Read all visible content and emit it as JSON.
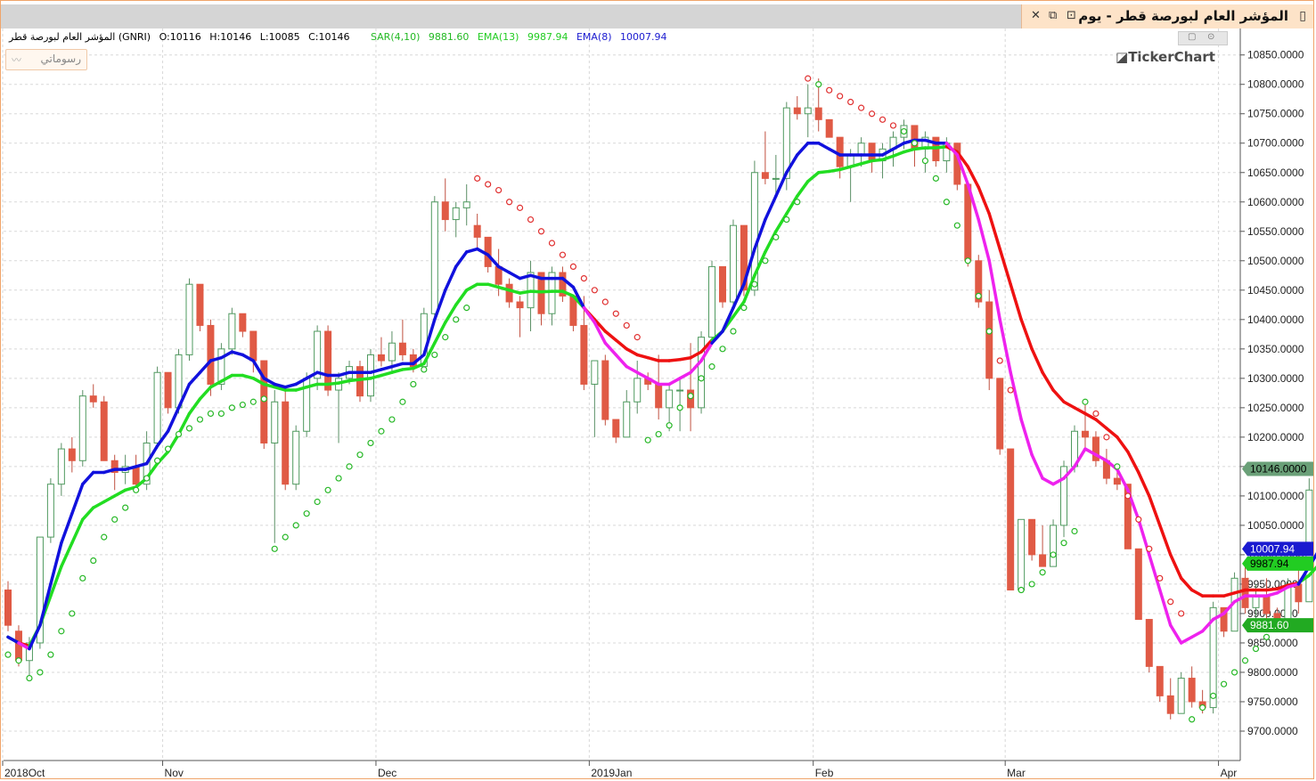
{
  "window": {
    "title": "المؤشر العام لبورصة قطر - يوم",
    "restore_icon": "restore-icon",
    "maximize_icon": "maximize-icon",
    "close_icon": "close-icon"
  },
  "info": {
    "symbol": "المؤشر العام لبورصة قطر (GNRI)",
    "ohlc": {
      "o": "O:10116",
      "h": "H:10146",
      "l": "L:10085",
      "c": "C:10146"
    },
    "indicators": [
      {
        "label": "SAR(4,10)",
        "value": "9881.60",
        "color": "#22b922"
      },
      {
        "label": "EMA(13)",
        "value": "9987.94",
        "color": "#22cc22"
      },
      {
        "label": "EMA(8)",
        "value": "10007.94",
        "color": "#1a1ad0"
      }
    ]
  },
  "drawings_label": "رسوماتي",
  "logo": "TickerChart",
  "chart_data": {
    "type": "candlestick",
    "ylim": [
      9650,
      10895
    ],
    "y_ticks": [
      "10850.0000",
      "10800.0000",
      "10750.0000",
      "10700.0000",
      "10650.0000",
      "10600.0000",
      "10550.0000",
      "10500.0000",
      "10450.0000",
      "10400.0000",
      "10350.0000",
      "10300.0000",
      "10250.0000",
      "10200.0000",
      "10150.0000",
      "10100.0000",
      "10050.0000",
      "10000.0000",
      "9950.0000",
      "9900.0000",
      "9850.0000",
      "9800.0000",
      "9750.0000",
      "9700.0000"
    ],
    "x_labels": [
      {
        "label": "2018Oct",
        "index": 0
      },
      {
        "label": "Nov",
        "index": 15
      },
      {
        "label": "Dec",
        "index": 35
      },
      {
        "label": "2019Jan",
        "index": 55
      },
      {
        "label": "Feb",
        "index": 76
      },
      {
        "label": "Mar",
        "index": 94
      },
      {
        "label": "Apr",
        "index": 114
      }
    ],
    "candles": [
      [
        9940,
        9955,
        9870,
        9880
      ],
      [
        9870,
        9880,
        9810,
        9820
      ],
      [
        9820,
        9860,
        9790,
        9850
      ],
      [
        9850,
        10030,
        9840,
        10030
      ],
      [
        10030,
        10130,
        10020,
        10120
      ],
      [
        10120,
        10190,
        10100,
        10180
      ],
      [
        10180,
        10200,
        10140,
        10160
      ],
      [
        10160,
        10280,
        10150,
        10270
      ],
      [
        10270,
        10290,
        10250,
        10260
      ],
      [
        10260,
        10270,
        10160,
        10160
      ],
      [
        10160,
        10170,
        10110,
        10140
      ],
      [
        10140,
        10170,
        10120,
        10150
      ],
      [
        10150,
        10170,
        10110,
        10120
      ],
      [
        10120,
        10210,
        10110,
        10190
      ],
      [
        10190,
        10320,
        10180,
        10310
      ],
      [
        10310,
        10300,
        10240,
        10250
      ],
      [
        10250,
        10350,
        10240,
        10340
      ],
      [
        10340,
        10470,
        10330,
        10460
      ],
      [
        10460,
        10440,
        10380,
        10390
      ],
      [
        10390,
        10400,
        10270,
        10290
      ],
      [
        10290,
        10360,
        10280,
        10350
      ],
      [
        10350,
        10420,
        10340,
        10410
      ],
      [
        10410,
        10410,
        10370,
        10380
      ],
      [
        10380,
        10380,
        10310,
        10330
      ],
      [
        10330,
        10320,
        10180,
        10190
      ],
      [
        10190,
        10280,
        10020,
        10260
      ],
      [
        10260,
        10280,
        10110,
        10120
      ],
      [
        10120,
        10220,
        10110,
        10210
      ],
      [
        10210,
        10310,
        10200,
        10300
      ],
      [
        10300,
        10390,
        10280,
        10380
      ],
      [
        10380,
        10390,
        10270,
        10280
      ],
      [
        10280,
        10310,
        10190,
        10300
      ],
      [
        10300,
        10330,
        10290,
        10320
      ],
      [
        10320,
        10330,
        10260,
        10270
      ],
      [
        10270,
        10350,
        10260,
        10340
      ],
      [
        10340,
        10370,
        10320,
        10330
      ],
      [
        10330,
        10380,
        10310,
        10360
      ],
      [
        10360,
        10400,
        10330,
        10340
      ],
      [
        10340,
        10350,
        10310,
        10320
      ],
      [
        10320,
        10420,
        10310,
        10410
      ],
      [
        10410,
        10610,
        10400,
        10600
      ],
      [
        10600,
        10640,
        10550,
        10570
      ],
      [
        10570,
        10600,
        10540,
        10590
      ],
      [
        10590,
        10630,
        10560,
        10600
      ],
      [
        10560,
        10580,
        10520,
        10540
      ],
      [
        10540,
        10540,
        10480,
        10490
      ],
      [
        10490,
        10520,
        10440,
        10460
      ],
      [
        10460,
        10470,
        10420,
        10430
      ],
      [
        10430,
        10440,
        10370,
        10420
      ],
      [
        10420,
        10500,
        10380,
        10480
      ],
      [
        10480,
        10480,
        10390,
        10410
      ],
      [
        10410,
        10490,
        10390,
        10480
      ],
      [
        10480,
        10490,
        10430,
        10440
      ],
      [
        10440,
        10430,
        10380,
        10390
      ],
      [
        10390,
        10440,
        10280,
        10290
      ],
      [
        10290,
        10310,
        10200,
        10330
      ],
      [
        10330,
        10340,
        10220,
        10230
      ],
      [
        10230,
        10230,
        10190,
        10200
      ],
      [
        10200,
        10280,
        10200,
        10260
      ],
      [
        10260,
        10330,
        10240,
        10300
      ],
      [
        10300,
        10310,
        10280,
        10290
      ],
      [
        10290,
        10340,
        10230,
        10250
      ],
      [
        10250,
        10290,
        10210,
        10280
      ],
      [
        10280,
        10300,
        10210,
        10280
      ],
      [
        10280,
        10360,
        10210,
        10250
      ],
      [
        10250,
        10380,
        10240,
        10370
      ],
      [
        10370,
        10500,
        10360,
        10490
      ],
      [
        10490,
        10480,
        10420,
        10430
      ],
      [
        10430,
        10570,
        10420,
        10560
      ],
      [
        10560,
        10540,
        10440,
        10450
      ],
      [
        10450,
        10670,
        10440,
        10650
      ],
      [
        10650,
        10720,
        10630,
        10640
      ],
      [
        10640,
        10680,
        10610,
        10640
      ],
      [
        10640,
        10770,
        10620,
        10760
      ],
      [
        10760,
        10780,
        10740,
        10750
      ],
      [
        10750,
        10800,
        10710,
        10760
      ],
      [
        10760,
        10810,
        10720,
        10740
      ],
      [
        10740,
        10710,
        10710,
        10710
      ],
      [
        10710,
        10700,
        10640,
        10660
      ],
      [
        10660,
        10690,
        10600,
        10680
      ],
      [
        10680,
        10710,
        10660,
        10700
      ],
      [
        10700,
        10690,
        10650,
        10670
      ],
      [
        10670,
        10700,
        10640,
        10690
      ],
      [
        10690,
        10720,
        10660,
        10710
      ],
      [
        10710,
        10740,
        10690,
        10730
      ],
      [
        10730,
        10700,
        10660,
        10690
      ],
      [
        10690,
        10720,
        10650,
        10710
      ],
      [
        10710,
        10700,
        10660,
        10670
      ],
      [
        10670,
        10710,
        10650,
        10700
      ],
      [
        10700,
        10700,
        10620,
        10630
      ],
      [
        10630,
        10600,
        10490,
        10500
      ],
      [
        10500,
        10510,
        10420,
        10430
      ],
      [
        10430,
        10450,
        10280,
        10300
      ],
      [
        10300,
        10250,
        10170,
        10180
      ],
      [
        10180,
        10160,
        9940,
        9940
      ],
      [
        9940,
        10060,
        9990,
        10060
      ],
      [
        10060,
        10060,
        9990,
        10000
      ],
      [
        10000,
        10050,
        9980,
        9980
      ],
      [
        9980,
        10060,
        9980,
        10050
      ],
      [
        10050,
        10160,
        10030,
        10150
      ],
      [
        10150,
        10220,
        10140,
        10210
      ],
      [
        10210,
        10260,
        10180,
        10200
      ],
      [
        10200,
        10210,
        10150,
        10160
      ],
      [
        10160,
        10180,
        10120,
        10130
      ],
      [
        10130,
        10150,
        10110,
        10120
      ],
      [
        10120,
        10030,
        10010,
        10010
      ],
      [
        10010,
        9940,
        9890,
        9890
      ],
      [
        9890,
        9840,
        9800,
        9810
      ],
      [
        9810,
        9790,
        9750,
        9760
      ],
      [
        9760,
        9790,
        9720,
        9730
      ],
      [
        9730,
        9800,
        9730,
        9790
      ],
      [
        9790,
        9810,
        9740,
        9750
      ],
      [
        9750,
        9770,
        9730,
        9740
      ],
      [
        9740,
        9920,
        9730,
        9910
      ],
      [
        9910,
        9900,
        9860,
        9870
      ],
      [
        9870,
        9970,
        9870,
        9960
      ],
      [
        9960,
        9980,
        9900,
        9910
      ],
      [
        9910,
        9950,
        9880,
        9930
      ],
      [
        9930,
        9960,
        9890,
        9900
      ],
      [
        9900,
        9910,
        9870,
        9880
      ],
      [
        9880,
        9960,
        9870,
        9950
      ],
      [
        9950,
        10000,
        9900,
        9920
      ],
      [
        9920,
        10130,
        9920,
        10110
      ],
      [
        10110,
        10150,
        10080,
        10146
      ]
    ],
    "ema8": [
      9860,
      9850,
      9840,
      9880,
      9950,
      10020,
      10070,
      10120,
      10140,
      10140,
      10145,
      10145,
      10150,
      10155,
      10185,
      10210,
      10250,
      10290,
      10310,
      10330,
      10335,
      10345,
      10340,
      10330,
      10300,
      10290,
      10285,
      10290,
      10300,
      10310,
      10305,
      10305,
      10310,
      10310,
      10310,
      10315,
      10320,
      10325,
      10325,
      10340,
      10400,
      10450,
      10490,
      10515,
      10520,
      10510,
      10490,
      10480,
      10470,
      10475,
      10470,
      10470,
      10470,
      10455,
      10420,
      10395,
      10360,
      10340,
      10320,
      10310,
      10300,
      10290,
      10290,
      10300,
      10310,
      10330,
      10360,
      10380,
      10420,
      10460,
      10520,
      10570,
      10610,
      10650,
      10680,
      10700,
      10700,
      10690,
      10680,
      10680,
      10680,
      10680,
      10680,
      10690,
      10700,
      10705,
      10705,
      10700,
      10700,
      10680,
      10630,
      10570,
      10500,
      10400,
      10310,
      10230,
      10170,
      10130,
      10120,
      10130,
      10150,
      10180,
      10170,
      10160,
      10145,
      10110,
      10060,
      10000,
      9940,
      9880,
      9850,
      9860,
      9870,
      9890,
      9900,
      9920,
      9930,
      9930,
      9930,
      9935,
      9945,
      9950,
      9980,
      10010
    ],
    "ema13": [
      9860,
      9850,
      9845,
      9880,
      9930,
      9980,
      10020,
      10060,
      10080,
      10090,
      10100,
      10110,
      10115,
      10130,
      10155,
      10175,
      10205,
      10240,
      10265,
      10285,
      10295,
      10305,
      10305,
      10300,
      10290,
      10285,
      10280,
      10280,
      10285,
      10290,
      10290,
      10292,
      10296,
      10298,
      10300,
      10305,
      10310,
      10315,
      10317,
      10325,
      10360,
      10395,
      10425,
      10450,
      10460,
      10460,
      10455,
      10450,
      10445,
      10448,
      10447,
      10448,
      10448,
      10440,
      10420,
      10400,
      10380,
      10365,
      10350,
      10340,
      10335,
      10330,
      10330,
      10332,
      10335,
      10345,
      10365,
      10380,
      10405,
      10430,
      10475,
      10515,
      10550,
      10580,
      10610,
      10635,
      10650,
      10652,
      10655,
      10660,
      10665,
      10670,
      10672,
      10678,
      10685,
      10690,
      10692,
      10692,
      10694,
      10685,
      10660,
      10625,
      10580,
      10520,
      10460,
      10400,
      10350,
      10310,
      10280,
      10260,
      10250,
      10240,
      10230,
      10215,
      10200,
      10175,
      10140,
      10100,
      10050,
      10000,
      9960,
      9940,
      9930,
      9930,
      9930,
      9935,
      9940,
      9940,
      9940,
      9942,
      9948,
      9952,
      9965,
      9985
    ],
    "sar": [
      9830,
      9820,
      9790,
      9800,
      9830,
      9870,
      9900,
      9960,
      9990,
      10030,
      10060,
      10080,
      10110,
      10130,
      10160,
      10180,
      10205,
      10215,
      10230,
      10240,
      10240,
      10250,
      10255,
      10260,
      10265,
      10010,
      10030,
      10050,
      10070,
      10090,
      10110,
      10130,
      10150,
      10170,
      10190,
      10210,
      10230,
      10260,
      10290,
      10315,
      10340,
      10370,
      10400,
      10420,
      10640,
      10630,
      10620,
      10600,
      10590,
      10570,
      10550,
      10530,
      10510,
      10490,
      10470,
      10450,
      10430,
      10410,
      10390,
      10370,
      10195,
      10205,
      10220,
      10250,
      10270,
      10300,
      10320,
      10350,
      10380,
      10420,
      10460,
      10500,
      10540,
      10570,
      10600,
      10810,
      10800,
      10790,
      10780,
      10770,
      10760,
      10750,
      10740,
      10730,
      10720,
      10700,
      10670,
      10640,
      10600,
      10560,
      10500,
      10440,
      10380,
      10330,
      10280,
      9940,
      9950,
      9970,
      10000,
      10020,
      10040,
      10260,
      10240,
      10200,
      10150,
      10100,
      10060,
      10010,
      9960,
      9920,
      9900,
      9720,
      9740,
      9760,
      9780,
      9800,
      9820,
      9840,
      9860,
      9880
    ]
  }
}
